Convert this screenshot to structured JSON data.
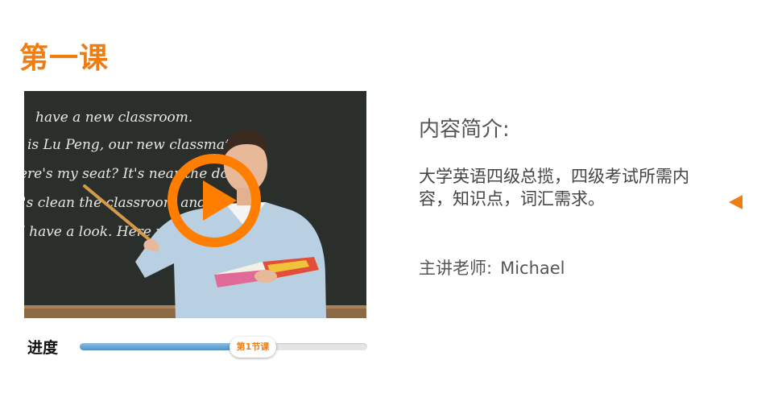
{
  "lesson": {
    "title": "第一课"
  },
  "video": {
    "blackboard_lines": [
      "have a new classroom.",
      "is Lu Peng, our new classmate.",
      "ere's my seat? It's near the door.",
      "'s clean the classroom and...",
      "I have a look. Here you..."
    ]
  },
  "progress": {
    "label": "进度",
    "marker_label": "第1节课",
    "fraction": 0.53
  },
  "info": {
    "heading": "内容简介:",
    "description": "大学英语四级总揽，四级考试所需内容，知识点，词汇需求。",
    "teacher_label": "主讲老师:",
    "teacher_name": "Michael"
  },
  "colors": {
    "accent": "#f07d12",
    "progress_fill": "#5a9bd0",
    "track": "#e3e4e6"
  },
  "icons": {
    "play": "play-icon",
    "next": "triangle-left-icon"
  }
}
